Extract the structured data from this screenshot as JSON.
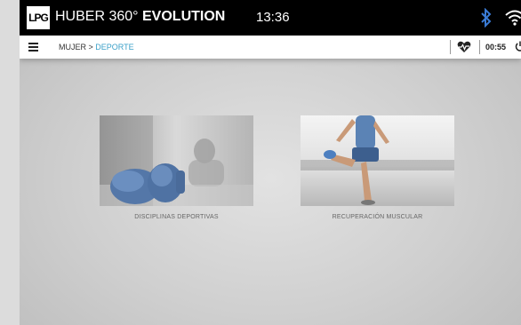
{
  "header": {
    "logo_text": "LPG",
    "title_light": "HUBER 360°",
    "title_bold": "EVOLUTION",
    "time": "13:36",
    "icons": [
      "bluetooth-icon",
      "wifi-icon"
    ]
  },
  "subbar": {
    "breadcrumb_parent": "MUJER",
    "breadcrumb_separator": " > ",
    "breadcrumb_current": "DEPORTE",
    "timer": "00:55",
    "icons": [
      "menu-icon",
      "heart-rate-icon",
      "power-icon"
    ]
  },
  "tiles": [
    {
      "label": "DISCIPLINAS DEPORTIVAS",
      "image": "boxing-gloves-photo"
    },
    {
      "label": "RECUPERACIÓN MUSCULAR",
      "image": "runner-stretching-photo"
    }
  ],
  "colors": {
    "accent": "#3aa0c8",
    "topbar": "#000000",
    "glove": "#5b7fb0"
  }
}
